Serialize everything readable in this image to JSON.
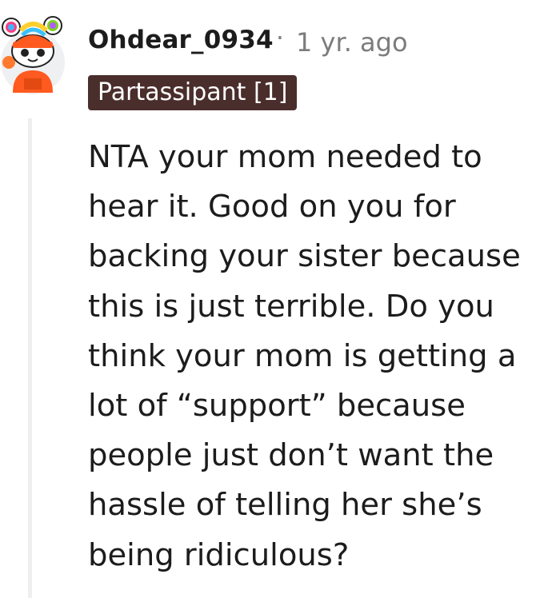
{
  "comment": {
    "username": "Ohdear_0934",
    "separator": "·",
    "timestamp": "1 yr. ago",
    "flair": "Partassipant [1]",
    "body": "NTA your mom needed to hear it. Good on you for backing your sister because this is just terrible. Do you think your mom is getting a lot of “support” because people just don’t want the hassle of telling her she’s being ridiculous?",
    "avatar_icon": "snoo-avatar-icon"
  },
  "colors": {
    "text": "#1c1c1c",
    "meta": "#7c7c7c",
    "flair_bg": "#4a2e2b",
    "flair_text": "#ffffff",
    "thread_line": "#edeff1"
  }
}
